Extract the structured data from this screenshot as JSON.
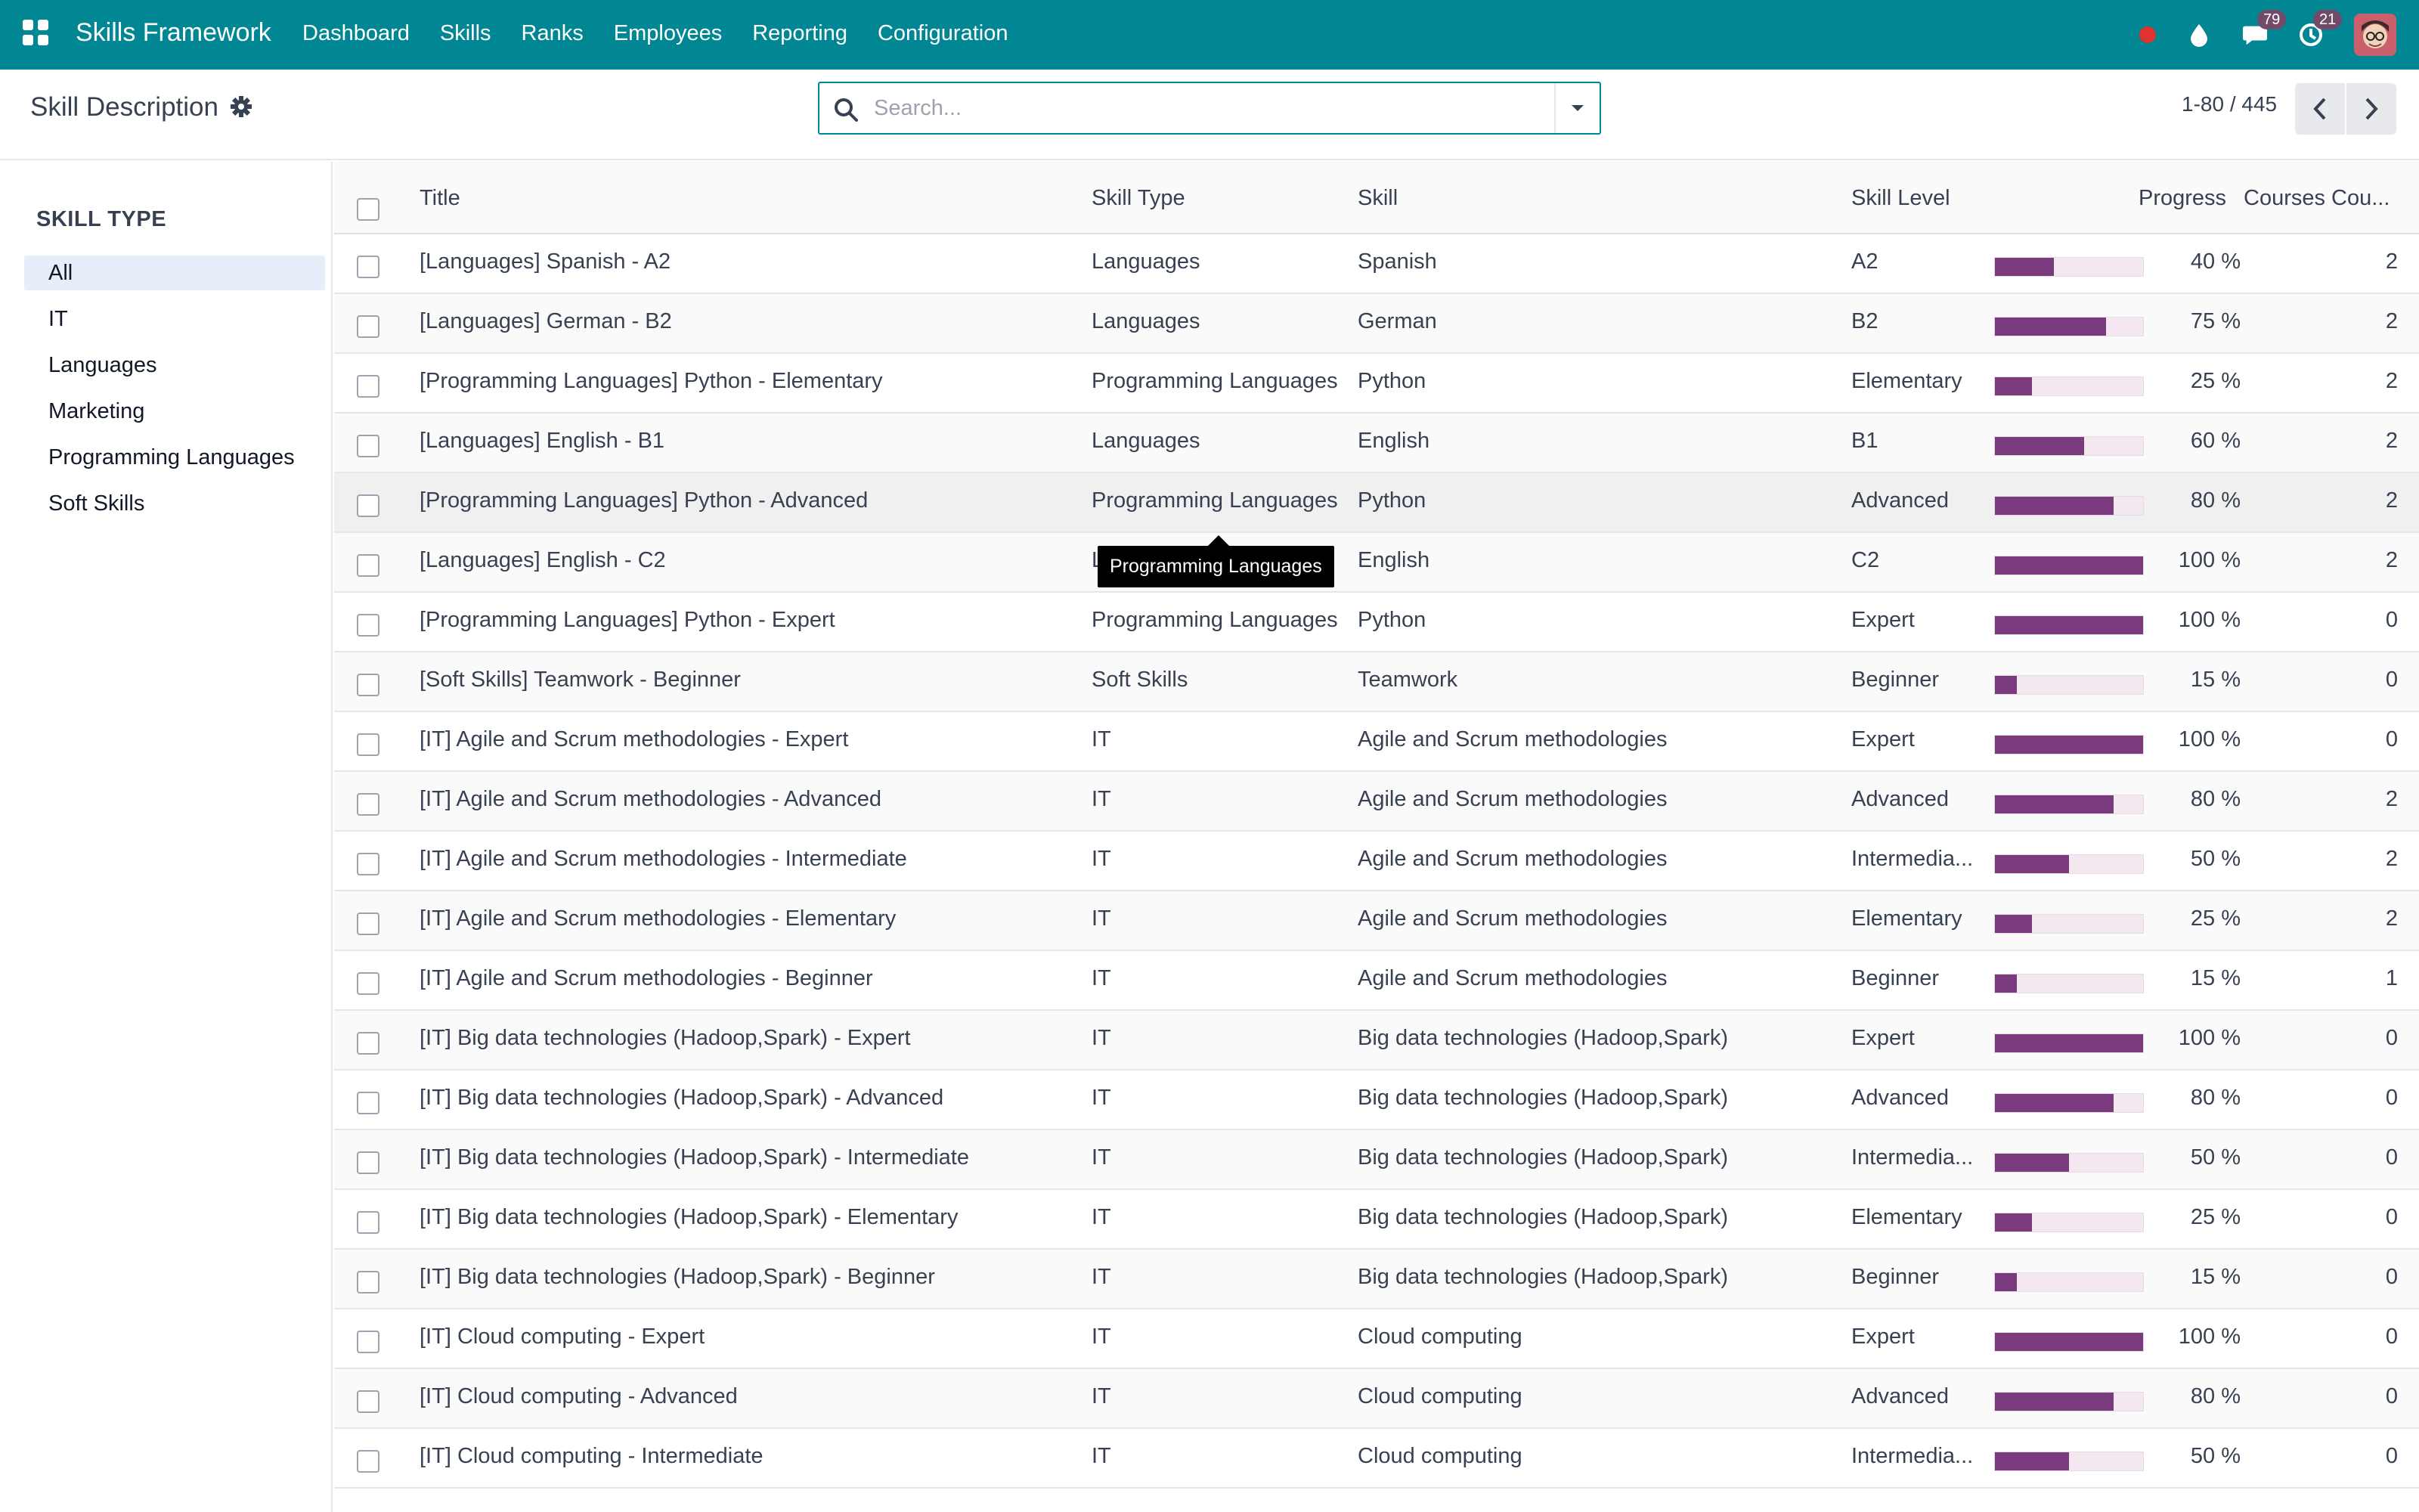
{
  "app": {
    "brand": "Skills Framework",
    "menu": [
      "Dashboard",
      "Skills",
      "Ranks",
      "Employees",
      "Reporting",
      "Configuration"
    ],
    "messages_count": "79",
    "activities_count": "21",
    "colors": {
      "topbar": "#018694",
      "progress": "#7a3b7e",
      "badge": "#714b67"
    }
  },
  "control": {
    "title": "Skill Description",
    "search_placeholder": "Search...",
    "pager": "1-80 / 445"
  },
  "sidebar": {
    "heading": "SKILL TYPE",
    "items": [
      {
        "label": "All",
        "active": true
      },
      {
        "label": "IT"
      },
      {
        "label": "Languages"
      },
      {
        "label": "Marketing"
      },
      {
        "label": "Programming Languages"
      },
      {
        "label": "Soft Skills"
      }
    ]
  },
  "table": {
    "headers": {
      "title": "Title",
      "skill_type": "Skill Type",
      "skill": "Skill",
      "skill_level": "Skill Level",
      "progress": "Progress",
      "courses": "Courses Cou..."
    },
    "rows": [
      {
        "title": "[Languages] Spanish - A2",
        "type": "Languages",
        "skill": "Spanish",
        "level": "A2",
        "progress": 40,
        "courses": "2"
      },
      {
        "title": "[Languages] German - B2",
        "type": "Languages",
        "skill": "German",
        "level": "B2",
        "progress": 75,
        "courses": "2"
      },
      {
        "title": "[Programming Languages] Python - Elementary",
        "type": "Programming Languages",
        "skill": "Python",
        "level": "Elementary",
        "progress": 25,
        "courses": "2"
      },
      {
        "title": "[Languages] English - B1",
        "type": "Languages",
        "skill": "English",
        "level": "B1",
        "progress": 60,
        "courses": "2"
      },
      {
        "title": "[Programming Languages] Python - Advanced",
        "type": "Programming Languages",
        "skill": "Python",
        "level": "Advanced",
        "progress": 80,
        "courses": "2"
      },
      {
        "title": "[Languages] English - C2",
        "type": "Languages",
        "skill": "English",
        "level": "C2",
        "progress": 100,
        "courses": "2"
      },
      {
        "title": "[Programming Languages] Python - Expert",
        "type": "Programming Languages",
        "skill": "Python",
        "level": "Expert",
        "progress": 100,
        "courses": "0"
      },
      {
        "title": "[Soft Skills] Teamwork - Beginner",
        "type": "Soft Skills",
        "skill": "Teamwork",
        "level": "Beginner",
        "progress": 15,
        "courses": "0"
      },
      {
        "title": "[IT] Agile and Scrum methodologies - Expert",
        "type": "IT",
        "skill": "Agile and Scrum methodologies",
        "level": "Expert",
        "progress": 100,
        "courses": "0"
      },
      {
        "title": "[IT] Agile and Scrum methodologies - Advanced",
        "type": "IT",
        "skill": "Agile and Scrum methodologies",
        "level": "Advanced",
        "progress": 80,
        "courses": "2"
      },
      {
        "title": "[IT] Agile and Scrum methodologies - Intermediate",
        "type": "IT",
        "skill": "Agile and Scrum methodologies",
        "level": "Intermedia...",
        "progress": 50,
        "courses": "2"
      },
      {
        "title": "[IT] Agile and Scrum methodologies - Elementary",
        "type": "IT",
        "skill": "Agile and Scrum methodologies",
        "level": "Elementary",
        "progress": 25,
        "courses": "2"
      },
      {
        "title": "[IT] Agile and Scrum methodologies - Beginner",
        "type": "IT",
        "skill": "Agile and Scrum methodologies",
        "level": "Beginner",
        "progress": 15,
        "courses": "1"
      },
      {
        "title": "[IT] Big data technologies (Hadoop,Spark) - Expert",
        "type": "IT",
        "skill": "Big data technologies (Hadoop,Spark)",
        "level": "Expert",
        "progress": 100,
        "courses": "0"
      },
      {
        "title": "[IT] Big data technologies (Hadoop,Spark) - Advanced",
        "type": "IT",
        "skill": "Big data technologies (Hadoop,Spark)",
        "level": "Advanced",
        "progress": 80,
        "courses": "0"
      },
      {
        "title": "[IT] Big data technologies (Hadoop,Spark) - Intermediate",
        "type": "IT",
        "skill": "Big data technologies (Hadoop,Spark)",
        "level": "Intermedia...",
        "progress": 50,
        "courses": "0"
      },
      {
        "title": "[IT] Big data technologies (Hadoop,Spark) - Elementary",
        "type": "IT",
        "skill": "Big data technologies (Hadoop,Spark)",
        "level": "Elementary",
        "progress": 25,
        "courses": "0"
      },
      {
        "title": "[IT] Big data technologies (Hadoop,Spark) - Beginner",
        "type": "IT",
        "skill": "Big data technologies (Hadoop,Spark)",
        "level": "Beginner",
        "progress": 15,
        "courses": "0"
      },
      {
        "title": "[IT] Cloud computing - Expert",
        "type": "IT",
        "skill": "Cloud computing",
        "level": "Expert",
        "progress": 100,
        "courses": "0"
      },
      {
        "title": "[IT] Cloud computing - Advanced",
        "type": "IT",
        "skill": "Cloud computing",
        "level": "Advanced",
        "progress": 80,
        "courses": "0"
      },
      {
        "title": "[IT] Cloud computing - Intermediate",
        "type": "IT",
        "skill": "Cloud computing",
        "level": "Intermedia...",
        "progress": 50,
        "courses": "0"
      }
    ],
    "hovered_row": 4
  },
  "tooltip": {
    "text": "Programming Languages"
  }
}
